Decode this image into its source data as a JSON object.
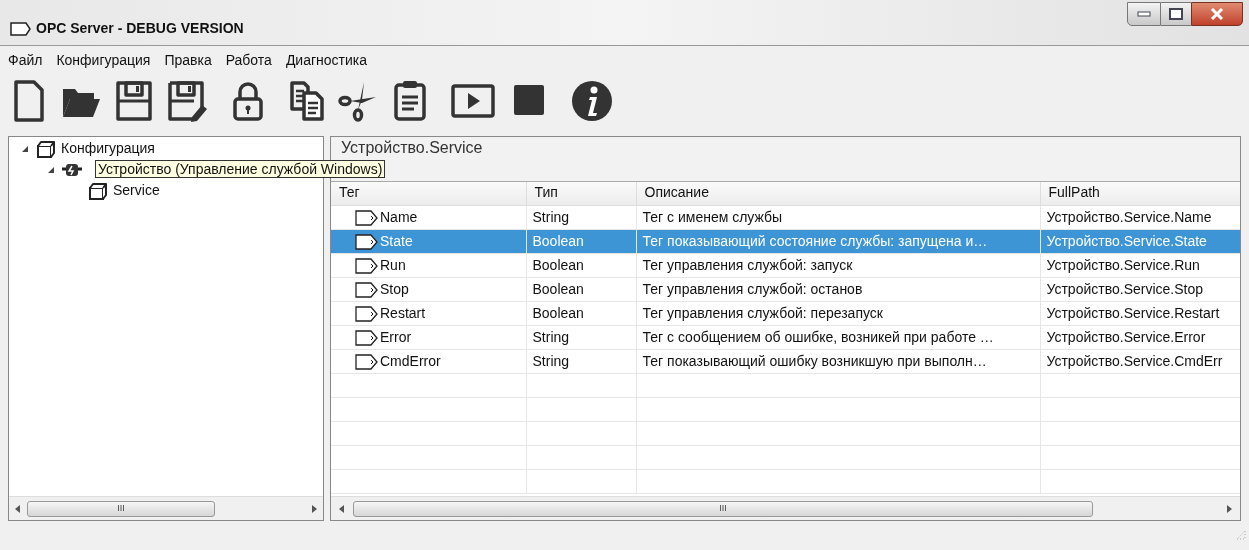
{
  "window": {
    "title": "OPC Server - DEBUG VERSION"
  },
  "menu": [
    "Файл",
    "Конфигурация",
    "Правка",
    "Работа",
    "Диагностика"
  ],
  "toolbar": [
    {
      "kind": "new"
    },
    {
      "kind": "open"
    },
    {
      "kind": "save"
    },
    {
      "kind": "saveas"
    },
    {
      "kind": "lock"
    },
    {
      "kind": "copy"
    },
    {
      "kind": "cut"
    },
    {
      "kind": "paste"
    },
    {
      "kind": "play"
    },
    {
      "kind": "stop"
    },
    {
      "kind": "info"
    }
  ],
  "tree": [
    {
      "label": "Конфигурация",
      "kind": "folder",
      "expanded": true,
      "children": [
        {
          "kind": "device",
          "expanded": true,
          "children": [
            {
              "label": "Service",
              "kind": "folder"
            }
          ]
        }
      ]
    }
  ],
  "tooltip": "Устройство (Управление службой Windows)",
  "panel_title": "Устройство.Service",
  "table": {
    "columns": [
      "Тег",
      "Тип",
      "Описание",
      "FullPath"
    ],
    "rows": [
      {
        "cells": [
          "Name",
          "String",
          "Тег с именем службы",
          "Устройство.Service.Name"
        ],
        "selected": false
      },
      {
        "cells": [
          "State",
          "Boolean",
          "Тег показывающий состояние службы: запущена и…",
          "Устройство.Service.State"
        ],
        "selected": true
      },
      {
        "cells": [
          "Run",
          "Boolean",
          "Тег управления службой: запуск",
          "Устройство.Service.Run"
        ],
        "selected": false
      },
      {
        "cells": [
          "Stop",
          "Boolean",
          "Тег управления службой: останов",
          "Устройство.Service.Stop"
        ],
        "selected": false
      },
      {
        "cells": [
          "Restart",
          "Boolean",
          "Тег управления службой: перезапуск",
          "Устройство.Service.Restart"
        ],
        "selected": false
      },
      {
        "cells": [
          "Error",
          "String",
          "Тег с сообщением об ошибке, возникей при работе …",
          "Устройство.Service.Error"
        ],
        "selected": false
      },
      {
        "cells": [
          "CmdError",
          "String",
          "Тег показывающий ошибку возникшую при выполн…",
          "Устройство.Service.CmdErr"
        ],
        "selected": false
      }
    ]
  },
  "scrollbar_grip": [
    "III",
    "III"
  ]
}
